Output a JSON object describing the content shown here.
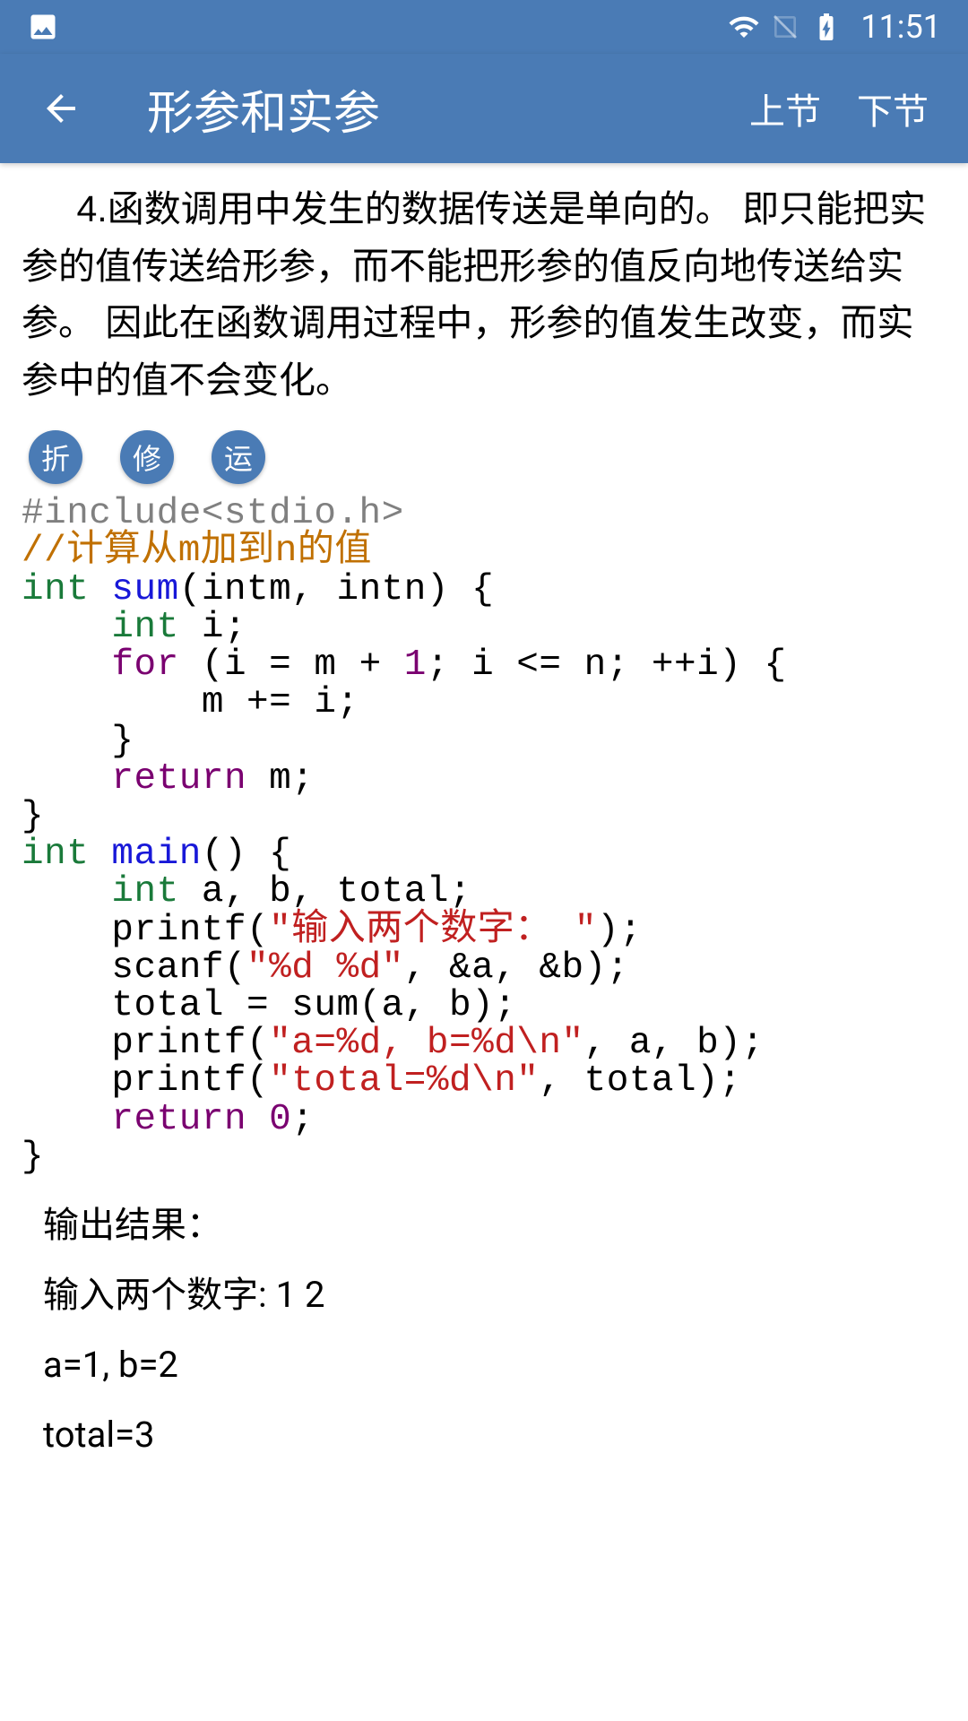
{
  "status": {
    "time": "11:51"
  },
  "appbar": {
    "title": "形参和实参",
    "prev_label": "上节",
    "next_label": "下节"
  },
  "paragraph": "4.函数调用中发生的数据传送是单向的。 即只能把实参的值传送给形参，而不能把形参的值反向地传送给实参。 因此在函数调用过程中，形参的值发生改变，而实参中的值不会变化。",
  "buttons": {
    "fold": "折",
    "edit": "修",
    "run": "运"
  },
  "code": {
    "include": "#include<stdio.h>",
    "comment": "//计算从m加到n的值",
    "int": "int",
    "sum": "sum",
    "sum_params": "(intm, intn) {",
    "i_decl": " i;",
    "for": "for",
    "for_open": " (i = m + ",
    "one": "1",
    "for_mid": "; i <= n; ++i) {",
    "m_plus": "        m += i;",
    "close_brace1": "    }",
    "return": "return",
    "ret_m": " m;",
    "close_brace2": "}",
    "main": "main",
    "main_sig": "() {",
    "ab_decl": " a, b, total;",
    "printf1_open": "    printf(",
    "str1": "\"输入两个数字： \"",
    "printf1_close": ");",
    "scanf_open": "    scanf(",
    "str2": "\"%d %d\"",
    "scanf_close": ", &a, &b);",
    "total_line": "    total = sum(a, b);",
    "printf2_open": "    printf(",
    "str3": "\"a=%d, b=%d\\n\"",
    "printf2_close": ", a, b);",
    "printf3_open": "    printf(",
    "str4": "\"total=%d\\n\"",
    "printf3_close": ", total);",
    "zero": "0",
    "semicolon": ";",
    "close_brace3": "}"
  },
  "output": {
    "heading": "输出结果：",
    "line1": "输入两个数字: 1 2",
    "line2": "a=1, b=2",
    "line3": "total=3"
  }
}
